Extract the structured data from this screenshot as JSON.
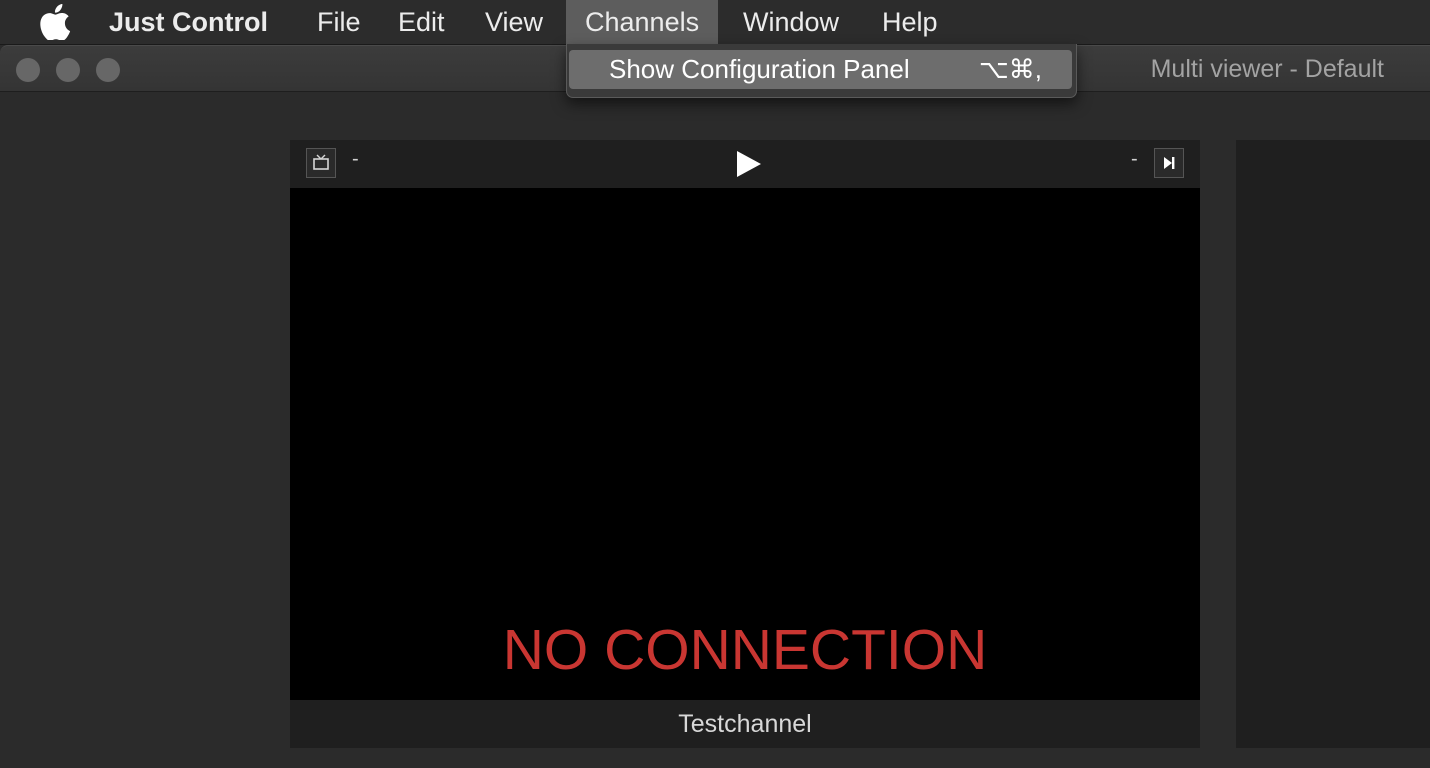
{
  "menubar": {
    "app_name": "Just Control",
    "items": [
      "File",
      "Edit",
      "View",
      "Channels",
      "Window",
      "Help"
    ],
    "open_item": "Channels"
  },
  "window": {
    "title": "Multi viewer - Default"
  },
  "channels_menu": {
    "items": [
      {
        "label": "Show Configuration Panel",
        "shortcut": "⌥⌘,"
      }
    ]
  },
  "tile": {
    "left_status": "-",
    "right_status": "-",
    "status_message": "NO CONNECTION",
    "channel_name": "Testchannel"
  },
  "colors": {
    "error_text": "#c93632"
  },
  "icons": [
    "apple-icon",
    "tv-icon",
    "play-icon",
    "skip-next-icon"
  ]
}
